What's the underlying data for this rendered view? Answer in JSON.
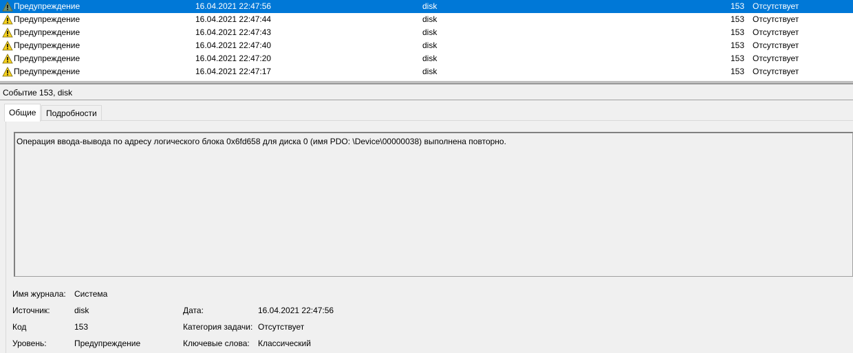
{
  "events": [
    {
      "level": "Предупреждение",
      "date": "16.04.2021 22:47:56",
      "source": "disk",
      "code": "153",
      "category": "Отсутствует",
      "selected": true
    },
    {
      "level": "Предупреждение",
      "date": "16.04.2021 22:47:44",
      "source": "disk",
      "code": "153",
      "category": "Отсутствует"
    },
    {
      "level": "Предупреждение",
      "date": "16.04.2021 22:47:43",
      "source": "disk",
      "code": "153",
      "category": "Отсутствует"
    },
    {
      "level": "Предупреждение",
      "date": "16.04.2021 22:47:40",
      "source": "disk",
      "code": "153",
      "category": "Отсутствует"
    },
    {
      "level": "Предупреждение",
      "date": "16.04.2021 22:47:20",
      "source": "disk",
      "code": "153",
      "category": "Отсутствует"
    },
    {
      "level": "Предупреждение",
      "date": "16.04.2021 22:47:17",
      "source": "disk",
      "code": "153",
      "category": "Отсутствует"
    }
  ],
  "detail": {
    "title": "Событие 153, disk",
    "tabs": [
      "Общие",
      "Подробности"
    ],
    "message": "Операция ввода-вывода по адресу логического блока 0x6fd658 для диска 0 (имя PDO: \\Device\\00000038) выполнена повторно.",
    "fields": {
      "log_label": "Имя журнала:",
      "log": "Система",
      "source_label": "Источник:",
      "source": "disk",
      "code_label": "Код",
      "code": "153",
      "level_label": "Уровень:",
      "level": "Предупреждение",
      "date_label": "Дата:",
      "date": "16.04.2021 22:47:56",
      "task_label": "Категория задачи:",
      "task": "Отсутствует",
      "keywords_label": "Ключевые слова:",
      "keywords": "Классический"
    }
  },
  "colors": {
    "selection": "#0078d7",
    "warning": "#f7d21e"
  }
}
